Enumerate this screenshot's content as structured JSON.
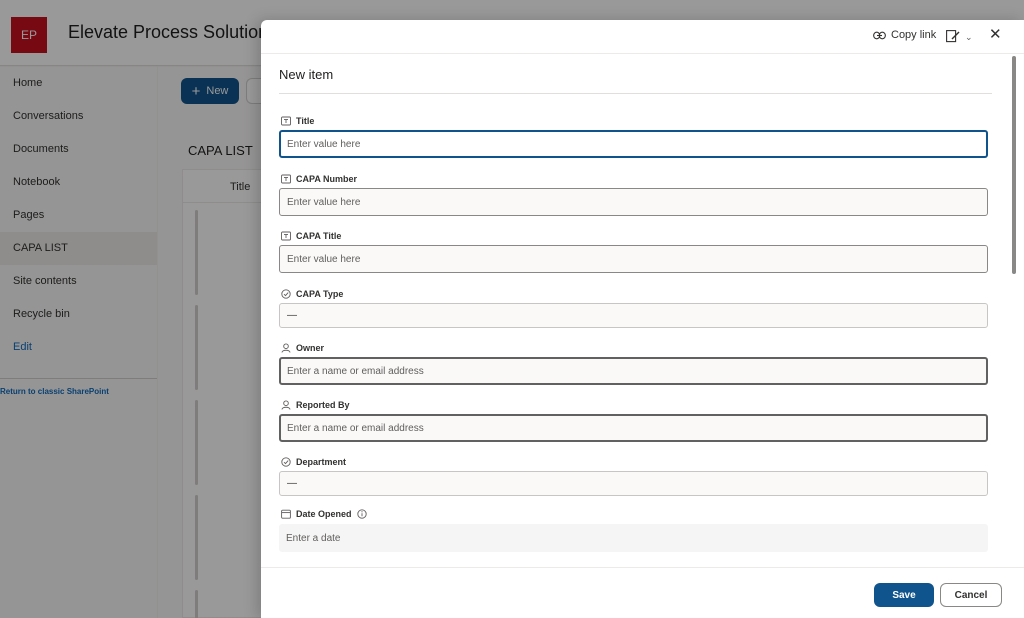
{
  "site": {
    "logo_text": "EP",
    "title": "Elevate Process Solutions",
    "brand_color": "#c50f1f"
  },
  "nav": {
    "items": [
      "Home",
      "Conversations",
      "Documents",
      "Notebook",
      "Pages",
      "CAPA LIST",
      "Site contents",
      "Recycle bin"
    ],
    "selected": "CAPA LIST",
    "edit_label": "Edit",
    "classic_link": "Return to classic SharePoint"
  },
  "toolbar": {
    "new_label": "New"
  },
  "list": {
    "title": "CAPA LIST",
    "column_header": "Title"
  },
  "panel": {
    "copy_link_label": "Copy link",
    "title": "New item",
    "fields": {
      "title": {
        "label": "Title",
        "placeholder": "Enter value here",
        "icon": "text-field-icon"
      },
      "capa_number": {
        "label": "CAPA Number",
        "placeholder": "Enter value here",
        "icon": "text-field-icon"
      },
      "capa_title": {
        "label": "CAPA Title",
        "placeholder": "Enter value here",
        "icon": "text-field-icon"
      },
      "capa_type": {
        "label": "CAPA Type",
        "value": "—",
        "icon": "choice-icon"
      },
      "owner": {
        "label": "Owner",
        "placeholder": "Enter a name or email address",
        "icon": "person-icon"
      },
      "reported_by": {
        "label": "Reported By",
        "placeholder": "Enter a name or email address",
        "icon": "person-icon"
      },
      "department": {
        "label": "Department",
        "value": "—",
        "icon": "choice-icon"
      },
      "date_opened": {
        "label": "Date Opened",
        "placeholder": "Enter a date",
        "icon": "calendar-icon"
      }
    },
    "save_label": "Save",
    "cancel_label": "Cancel",
    "accent_color": "#0f548c"
  }
}
